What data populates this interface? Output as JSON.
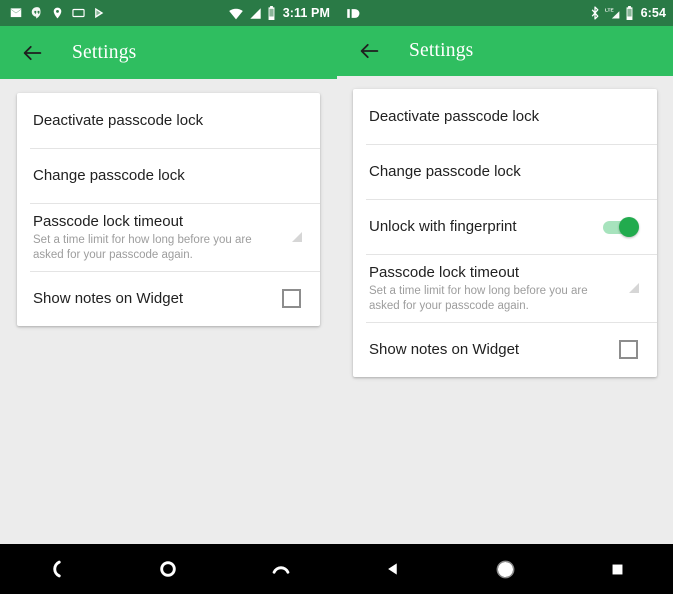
{
  "screens": [
    {
      "id": "left",
      "status_bar": {
        "notification_icons": [
          "mail-icon",
          "hangouts-icon",
          "location-pin-icon",
          "cast-screen-icon",
          "play-store-icon"
        ],
        "system_icons": [
          "wifi-icon",
          "cellular-signal-icon",
          "battery-icon"
        ],
        "clock": "3:11 PM",
        "background_color": "#2a7a46"
      },
      "toolbar": {
        "back_icon": "back-arrow-icon",
        "title": "Settings",
        "background_color": "#2fbe60"
      },
      "settings_rows": [
        {
          "title": "Deactivate passcode lock",
          "subtitle": "",
          "control": "none"
        },
        {
          "title": "Change passcode lock",
          "subtitle": "",
          "control": "none"
        },
        {
          "title": "Passcode lock timeout",
          "subtitle": "Set a time limit for how long before you are asked for your passcode again.",
          "control": "spinner"
        },
        {
          "title": "Show notes on Widget",
          "subtitle": "",
          "control": "checkbox",
          "checked": false
        }
      ],
      "nav_bar": {
        "buttons": [
          "back-nav-icon",
          "home-nav-icon",
          "recents-nav-icon"
        ],
        "style": "outline"
      }
    },
    {
      "id": "right",
      "status_bar": {
        "notification_icons": [
          "pushbullet-icon"
        ],
        "system_icons": [
          "bluetooth-icon",
          "lte-signal-icon",
          "battery-icon"
        ],
        "clock": "6:54",
        "background_color": "#2a7a46"
      },
      "toolbar": {
        "back_icon": "back-arrow-icon",
        "title": "Settings",
        "background_color": "#2fbe60"
      },
      "settings_rows": [
        {
          "title": "Deactivate passcode lock",
          "subtitle": "",
          "control": "none"
        },
        {
          "title": "Change passcode lock",
          "subtitle": "",
          "control": "none"
        },
        {
          "title": "Unlock with fingerprint",
          "subtitle": "",
          "control": "switch",
          "checked": true
        },
        {
          "title": "Passcode lock timeout",
          "subtitle": "Set a time limit for how long before you are asked for your passcode again.",
          "control": "spinner"
        },
        {
          "title": "Show notes on Widget",
          "subtitle": "",
          "control": "checkbox",
          "checked": false
        }
      ],
      "nav_bar": {
        "buttons": [
          "back-nav-icon",
          "home-nav-icon",
          "recents-nav-icon"
        ],
        "style": "solid"
      }
    }
  ],
  "colors": {
    "status_bar": "#2a7a46",
    "toolbar": "#2fbe60",
    "page_background": "#ececec",
    "card": "#ffffff",
    "title_text": "#212121",
    "subtitle_text": "#9d9d9d",
    "switch_on": "#22ab4e",
    "nav_bar": "#000000"
  }
}
